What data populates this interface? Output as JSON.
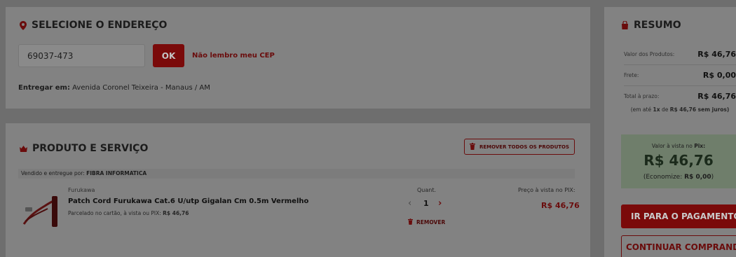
{
  "address": {
    "title": "SELECIONE O ENDEREÇO",
    "cep_value": "69037-473",
    "ok_label": "OK",
    "forgot_cep_label": "Não lembro meu CEP",
    "deliver_label": "Entregar em:",
    "deliver_value": "Avenida Coronel Teixeira - Manaus / AM"
  },
  "product_section": {
    "title": "PRODUTO E SERVIÇO",
    "remove_all_label": "REMOVER TODOS OS PRODUTOS",
    "seller_prefix": "Vendido e entregue por:",
    "seller_name": "FIBRA INFORMATICA",
    "item": {
      "brand": "Furukawa",
      "name": "Patch Cord Furukawa Cat.6 U/utp Gigalan Cm 0.5m Vermelho",
      "installments_text": "Parcelado no cartão, à vista ou PIX:",
      "installments_value": "R$ 46,76",
      "qty_label": "Quant.",
      "qty_decrease": "‹",
      "qty_value": "1",
      "qty_increase": "›",
      "remove_label": "REMOVER",
      "price_label": "Preço à vista no PIX:",
      "price": "R$ 46,76"
    }
  },
  "summary": {
    "title": "RESUMO",
    "products_label": "Valor dos Produtos:",
    "products_value": "R$ 46,76",
    "freight_label": "Frete:",
    "freight_value": "R$ 0,00",
    "total_label": "Total à prazo:",
    "total_value": "R$ 46,76",
    "note_prefix": "(em até",
    "note_times": "1x",
    "note_mid": "de",
    "note_value": "R$ 46,76 sem juros)",
    "pix_label_prefix": "Valor à vista no",
    "pix_label_bold": "Pix:",
    "pix_value": "R$ 46,76",
    "pix_savings_prefix": "(Economize:",
    "pix_savings_value": "R$ 0,00",
    "pix_savings_suffix": ")",
    "pay_button": "IR PARA O PAGAMENTO",
    "continue_button": "CONTINUAR COMPRANDO"
  },
  "colors": {
    "accent": "#b10e0e",
    "pix_box": "#d7f0d2",
    "overlay": "#6e6e6e"
  },
  "icons": [
    "location-pin-icon",
    "shopping-bag-icon",
    "crown-icon",
    "trash-icon"
  ]
}
